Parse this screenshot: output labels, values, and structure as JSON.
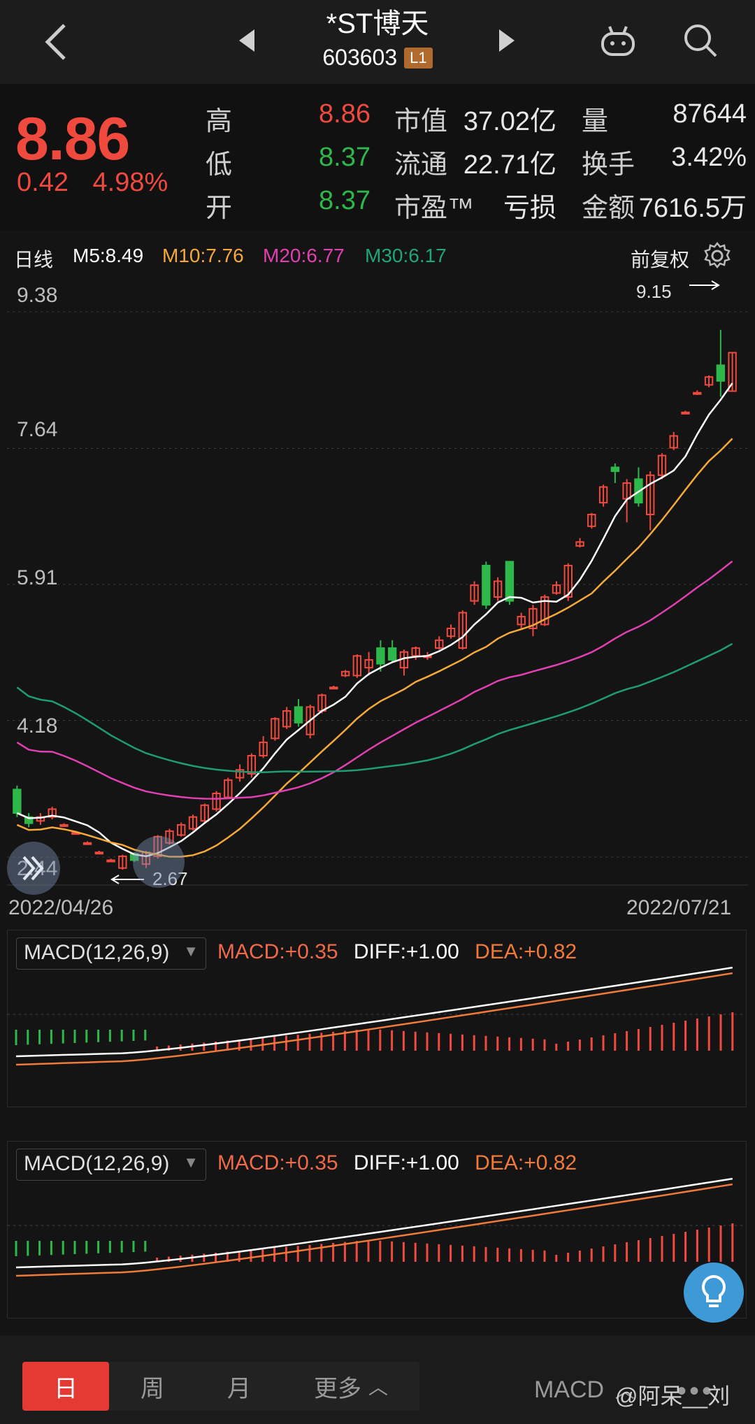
{
  "header": {
    "stock_name": "*ST博天",
    "stock_code": "603603",
    "level": "L1"
  },
  "quote": {
    "price": "8.86",
    "change": "0.42",
    "change_pct": "4.98%",
    "rows": [
      {
        "label1": "高",
        "val1": "8.86",
        "label2": "市值",
        "val2": "37.02亿",
        "label3": "量",
        "val3": "87644"
      },
      {
        "label1": "低",
        "val1": "8.37",
        "label2": "流通",
        "val2": "22.71亿",
        "label3": "换手",
        "val3": "3.42%"
      },
      {
        "label1": "开",
        "val1": "8.37",
        "label2": "市盈™",
        "val2": "亏损",
        "label3": "金额",
        "val3": "7616.5万"
      }
    ]
  },
  "ma": {
    "period": "日线",
    "m5": "M5:8.49",
    "m10": "M10:7.76",
    "m20": "M20:6.77",
    "m30": "M30:6.17",
    "adjust": "前复权"
  },
  "colors": {
    "up": "#f04a3f",
    "down": "#2fb84a",
    "m5": "#ffffff",
    "m10": "#f4a93a",
    "m20": "#e040b0",
    "m30": "#1f9c72"
  },
  "chart_data": {
    "type": "candlestick",
    "y_ticks": [
      "9.38",
      "7.64",
      "5.91",
      "4.18",
      "2.44"
    ],
    "ylim": [
      2.44,
      9.38
    ],
    "x_start": "2022/04/26",
    "x_end": "2022/07/21",
    "max_label": "9.15",
    "min_label": "2.67",
    "candles": [
      [
        3.3,
        3.0,
        3.35,
        2.95
      ],
      [
        2.95,
        2.87,
        3.0,
        2.82
      ],
      [
        2.9,
        2.95,
        3.0,
        2.85
      ],
      [
        2.95,
        3.05,
        3.08,
        2.92
      ],
      [
        2.85,
        2.85,
        2.87,
        2.83
      ],
      [
        2.75,
        2.75,
        2.77,
        2.73
      ],
      [
        2.62,
        2.62,
        2.64,
        2.6
      ],
      [
        2.5,
        2.5,
        2.52,
        2.48
      ],
      [
        2.4,
        2.4,
        2.42,
        2.38
      ],
      [
        2.3,
        2.45,
        2.47,
        2.28
      ],
      [
        2.48,
        2.4,
        2.5,
        2.38
      ],
      [
        2.35,
        2.5,
        2.52,
        2.3
      ],
      [
        2.45,
        2.7,
        2.72,
        2.42
      ],
      [
        2.62,
        2.77,
        2.8,
        2.6
      ],
      [
        2.72,
        2.85,
        2.88,
        2.7
      ],
      [
        2.8,
        2.95,
        2.98,
        2.78
      ],
      [
        2.9,
        3.1,
        3.12,
        2.88
      ],
      [
        3.05,
        3.25,
        3.28,
        3.02
      ],
      [
        3.2,
        3.42,
        3.45,
        3.18
      ],
      [
        3.45,
        3.55,
        3.62,
        3.4
      ],
      [
        3.5,
        3.73,
        3.76,
        3.45
      ],
      [
        3.73,
        3.9,
        3.98,
        3.7
      ],
      [
        3.95,
        4.2,
        4.22,
        3.92
      ],
      [
        4.1,
        4.3,
        4.35,
        4.07
      ],
      [
        4.35,
        4.15,
        4.45,
        4.1
      ],
      [
        4.0,
        4.35,
        4.38,
        3.95
      ],
      [
        4.3,
        4.5,
        4.52,
        4.27
      ],
      [
        4.6,
        4.6,
        4.62,
        4.58
      ],
      [
        4.75,
        4.8,
        4.82,
        4.73
      ],
      [
        4.75,
        5.0,
        5.02,
        4.72
      ],
      [
        4.85,
        4.95,
        5.05,
        4.75
      ],
      [
        5.1,
        4.9,
        5.2,
        4.8
      ],
      [
        5.1,
        4.95,
        5.2,
        4.92
      ],
      [
        4.85,
        5.05,
        5.08,
        4.75
      ],
      [
        5.0,
        5.1,
        5.12,
        4.95
      ],
      [
        5.0,
        5.0,
        5.05,
        4.95
      ],
      [
        5.1,
        5.2,
        5.25,
        5.08
      ],
      [
        5.25,
        5.35,
        5.4,
        5.22
      ],
      [
        5.1,
        5.55,
        5.58,
        5.08
      ],
      [
        5.7,
        5.9,
        5.95,
        5.65
      ],
      [
        6.15,
        5.65,
        6.2,
        5.6
      ],
      [
        5.75,
        5.95,
        6.0,
        5.7
      ],
      [
        6.2,
        5.7,
        6.2,
        5.65
      ],
      [
        5.4,
        5.5,
        5.55,
        5.35
      ],
      [
        5.35,
        5.6,
        5.65,
        5.25
      ],
      [
        5.4,
        5.75,
        5.78,
        5.38
      ],
      [
        5.8,
        5.9,
        5.95,
        5.78
      ],
      [
        5.75,
        6.15,
        6.18,
        5.7
      ],
      [
        6.4,
        6.45,
        6.5,
        6.38
      ],
      [
        6.65,
        6.8,
        6.82,
        6.62
      ],
      [
        6.95,
        7.15,
        7.18,
        6.9
      ],
      [
        7.4,
        7.35,
        7.45,
        7.2
      ],
      [
        7.0,
        7.2,
        7.25,
        6.7
      ],
      [
        7.25,
        6.95,
        7.4,
        6.9
      ],
      [
        6.8,
        7.3,
        7.35,
        6.6
      ],
      [
        7.3,
        7.55,
        7.58,
        7.25
      ],
      [
        7.65,
        7.8,
        7.85,
        7.62
      ],
      [
        8.1,
        8.1,
        8.12,
        8.08
      ],
      [
        8.35,
        8.35,
        8.38,
        8.32
      ],
      [
        8.45,
        8.55,
        8.57,
        8.42
      ],
      [
        8.7,
        8.5,
        9.15,
        8.3
      ],
      [
        8.37,
        8.86,
        8.86,
        8.37
      ]
    ]
  },
  "macd": [
    {
      "selector": "MACD(12,26,9)",
      "macd": "MACD:+0.35",
      "diff": "DIFF:+1.00",
      "dea": "DEA:+0.82"
    },
    {
      "selector": "MACD(12,26,9)",
      "macd": "MACD:+0.35",
      "diff": "DIFF:+1.00",
      "dea": "DEA:+0.82"
    }
  ],
  "tabs": {
    "day": "日",
    "week": "周",
    "month": "月",
    "more": "更多",
    "indicator": "MACD",
    "dots": "•••"
  },
  "watermark": "@阿呆__刘"
}
